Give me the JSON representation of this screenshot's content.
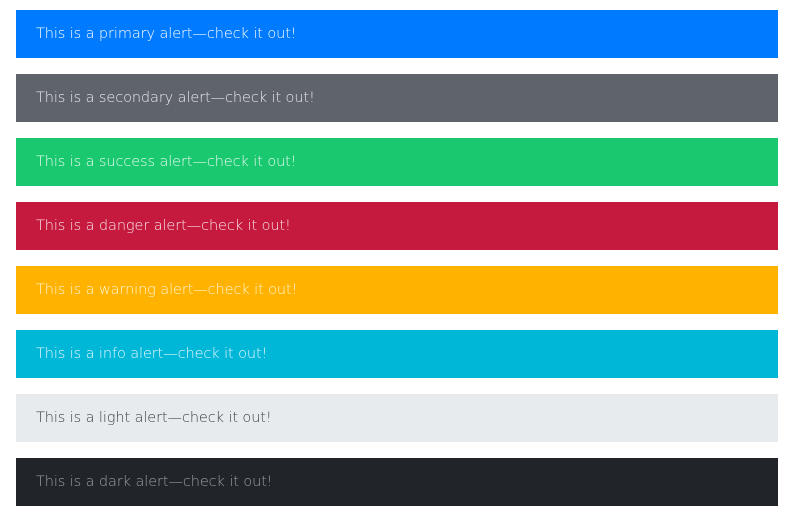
{
  "alerts": [
    {
      "variant": "primary",
      "text": "This is a primary alert—check it out!",
      "background": "#007bff"
    },
    {
      "variant": "secondary",
      "text": "This is a secondary alert—check it out!",
      "background": "#5f646c"
    },
    {
      "variant": "success",
      "text": "This is a success alert—check it out!",
      "background": "#1ac870"
    },
    {
      "variant": "danger",
      "text": "This is a danger alert—check it out!",
      "background": "#c5193e"
    },
    {
      "variant": "warning",
      "text": "This is a warning alert—check it out!",
      "background": "#ffb300"
    },
    {
      "variant": "info",
      "text": "This is a info alert—check it out!",
      "background": "#00b7d8"
    },
    {
      "variant": "light",
      "text": "This is a light alert—check it out!",
      "background": "#e8ebee"
    },
    {
      "variant": "dark",
      "text": "This is a dark alert—check it out!",
      "background": "#212429"
    }
  ]
}
